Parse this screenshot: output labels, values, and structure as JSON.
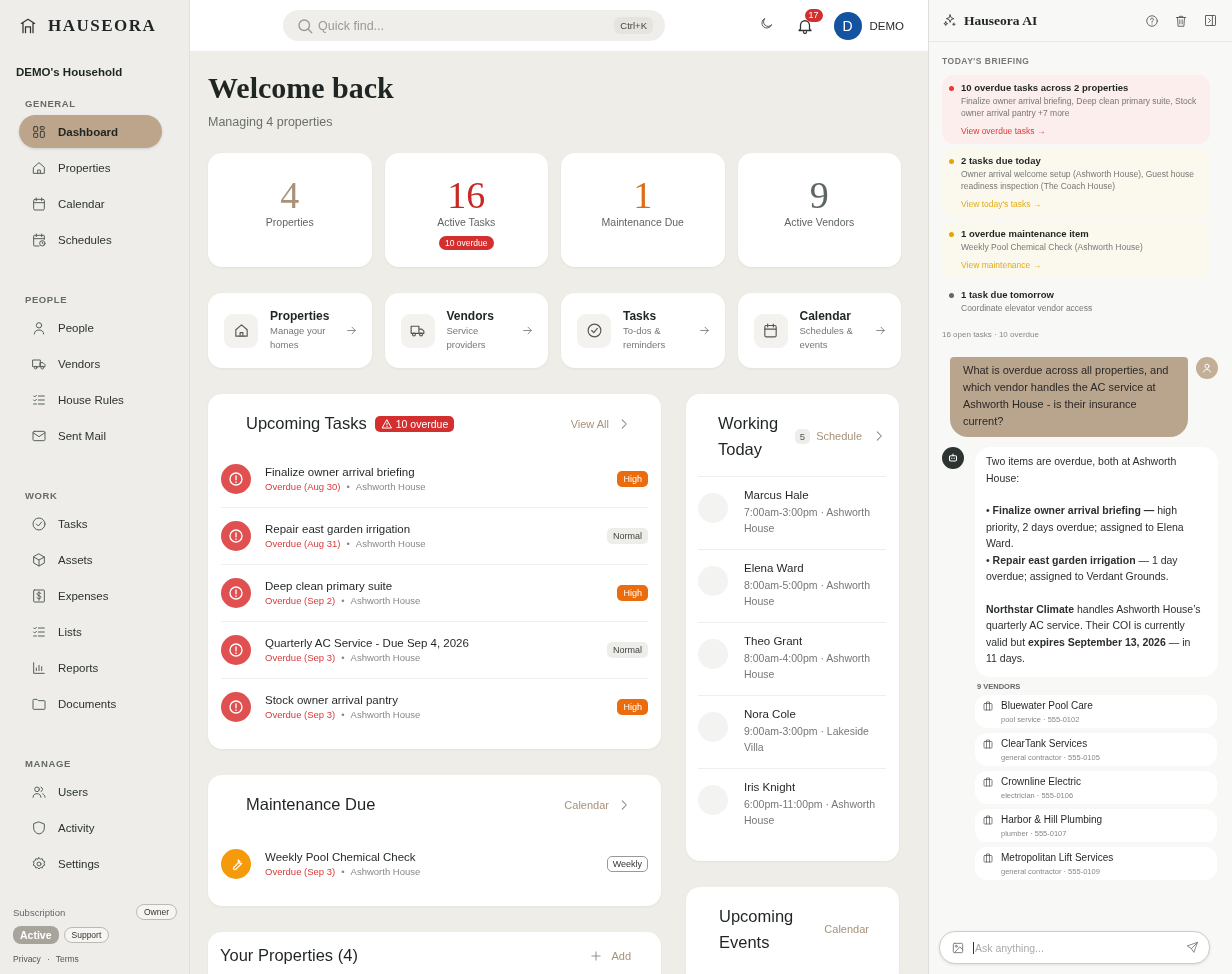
{
  "brand": {
    "name": "HAUSEORA"
  },
  "household": "DEMO's Household",
  "nav": [
    {
      "heading": "GENERAL",
      "items": [
        {
          "label": "Dashboard",
          "selected": true
        },
        {
          "label": "Properties",
          "selected": false
        },
        {
          "label": "Calendar",
          "selected": false
        },
        {
          "label": "Schedules",
          "selected": false
        }
      ]
    },
    {
      "heading": "PEOPLE",
      "items": [
        {
          "label": "People",
          "selected": false
        },
        {
          "label": "Vendors",
          "selected": false
        },
        {
          "label": "House Rules",
          "selected": false
        },
        {
          "label": "Sent Mail",
          "selected": false
        }
      ]
    },
    {
      "heading": "WORK",
      "items": [
        {
          "label": "Tasks",
          "selected": false
        },
        {
          "label": "Assets",
          "selected": false
        },
        {
          "label": "Expenses",
          "selected": false
        },
        {
          "label": "Lists",
          "selected": false
        },
        {
          "label": "Reports",
          "selected": false
        },
        {
          "label": "Documents",
          "selected": false
        }
      ]
    },
    {
      "heading": "MANAGE",
      "items": [
        {
          "label": "Users",
          "selected": false
        },
        {
          "label": "Activity",
          "selected": false
        },
        {
          "label": "Settings",
          "selected": false
        }
      ]
    }
  ],
  "subscription": {
    "label": "Subscription",
    "role": "Owner",
    "status": "Active",
    "support": "Support"
  },
  "footer": {
    "links": [
      "Privacy",
      "Terms"
    ],
    "separator": "·"
  },
  "header": {
    "search": {
      "placeholder": "Quick find...",
      "shortcut": "Ctrl+K"
    },
    "notifications": "17",
    "user": {
      "initial": "D",
      "name": "DEMO"
    }
  },
  "welcome": {
    "title": "Welcome back",
    "subtitle": "Managing 4 properties"
  },
  "stats": [
    {
      "value": "4",
      "label": "Properties",
      "color": "#a8927a"
    },
    {
      "value": "16",
      "label": "Active Tasks",
      "color": "#c62a24",
      "badge": "10 overdue"
    },
    {
      "value": "1",
      "label": "Maintenance Due",
      "color": "#dd6c12"
    },
    {
      "value": "9",
      "label": "Active Vendors",
      "color": "#5d6663"
    }
  ],
  "quick_links": [
    {
      "title": "Properties",
      "subtitle": "Manage your homes"
    },
    {
      "title": "Vendors",
      "subtitle": "Service providers"
    },
    {
      "title": "Tasks",
      "subtitle": "To-dos & reminders"
    },
    {
      "title": "Calendar",
      "subtitle": "Schedules & events"
    }
  ],
  "upcoming_tasks": {
    "title": "Upcoming Tasks",
    "badge": "10 overdue",
    "action": "View All",
    "separator": "•",
    "items": [
      {
        "title": "Finalize owner arrival briefing",
        "due": "Overdue (Aug 30)",
        "property": "Ashworth House",
        "priority": {
          "label": "High",
          "kind": "high"
        }
      },
      {
        "title": "Repair east garden irrigation",
        "due": "Overdue (Aug 31)",
        "property": "Ashworth House",
        "priority": {
          "label": "Normal",
          "kind": "normal"
        }
      },
      {
        "title": "Deep clean primary suite",
        "due": "Overdue (Sep 2)",
        "property": "Ashworth House",
        "priority": {
          "label": "High",
          "kind": "high"
        }
      },
      {
        "title": "Quarterly AC Service - Due Sep 4, 2026",
        "due": "Overdue (Sep 3)",
        "property": "Ashworth House",
        "priority": {
          "label": "Normal",
          "kind": "normal"
        }
      },
      {
        "title": "Stock owner arrival pantry",
        "due": "Overdue (Sep 3)",
        "property": "Ashworth House",
        "priority": {
          "label": "High",
          "kind": "high"
        }
      }
    ]
  },
  "maintenance_due": {
    "title": "Maintenance Due",
    "action": "Calendar",
    "separator": "•",
    "items": [
      {
        "title": "Weekly Pool Chemical Check",
        "due": "Overdue (Sep 3)",
        "property": "Ashworth House",
        "frequency": "Weekly"
      }
    ]
  },
  "your_properties": {
    "title": "Your Properties (4)",
    "action": "Add"
  },
  "working_today": {
    "title": "Working Today",
    "count": "5",
    "action": "Schedule",
    "people": [
      {
        "name": "Marcus Hale",
        "shift": "7:00am-3:00pm · Ashworth House"
      },
      {
        "name": "Elena Ward",
        "shift": "8:00am-5:00pm · Ashworth House"
      },
      {
        "name": "Theo Grant",
        "shift": "8:00am-4:00pm · Ashworth House"
      },
      {
        "name": "Nora Cole",
        "shift": "9:00am-3:00pm · Lakeside Villa"
      },
      {
        "name": "Iris Knight",
        "shift": "6:00pm-11:00pm · Ashworth House"
      }
    ]
  },
  "upcoming_events": {
    "title": "Upcoming Events",
    "action": "Calendar"
  },
  "assistant": {
    "title": "Hauseora AI",
    "briefing_heading": "TODAY'S BRIEFING",
    "briefing": [
      {
        "kind": "overdue",
        "title": "10 overdue tasks across 2 properties",
        "detail": "Finalize owner arrival briefing, Deep clean primary suite, Stock owner arrival pantry +7 more",
        "link": "View overdue tasks →"
      },
      {
        "kind": "today",
        "title": "2 tasks due today",
        "detail": "Owner arrival welcome setup (Ashworth House), Guest house readiness inspection (The Coach House)",
        "link": "View today's tasks →"
      },
      {
        "kind": "maintenance",
        "title": "1 overdue maintenance item",
        "detail": "Weekly Pool Chemical Check (Ashworth House)",
        "link": "View maintenance →"
      },
      {
        "kind": "tomorrow",
        "title": "1 task due tomorrow",
        "detail": "Coordinate elevator vendor access"
      }
    ],
    "summary": "16 open tasks · 10 overdue",
    "messages": [
      {
        "kind": "user",
        "paragraphs": [
          "What is overdue across all properties, and which vendor handles the AC service at Ashworth House - is their insurance current?"
        ]
      },
      {
        "kind": "assistant",
        "paragraphs": [
          "Two items are overdue, both at Ashworth House:",
          "• **Finalize owner arrival briefing —** high priority, 2 days overdue; assigned to Elena Ward.\n• **Repair east garden irrigation** — 1 day overdue; assigned to Verdant Grounds.",
          "**Northstar Climate** handles Ashworth House’s quarterly AC service. Their COI is currently valid but **expires September 13, 2026** — in 11 days."
        ]
      }
    ],
    "vendors_heading": "9 VENDORS",
    "vendors": [
      {
        "name": "Bluewater Pool Care",
        "detail": "pool service · 555-0102"
      },
      {
        "name": "ClearTank Services",
        "detail": "general contractor · 555-0105"
      },
      {
        "name": "Crownline Electric",
        "detail": "electrician · 555-0106"
      },
      {
        "name": "Harbor & Hill Plumbing",
        "detail": "plumber · 555-0107"
      },
      {
        "name": "Metropolitan Lift Services",
        "detail": "general contractor · 555-0109"
      }
    ],
    "input": {
      "placeholder": "Ask anything..."
    }
  }
}
